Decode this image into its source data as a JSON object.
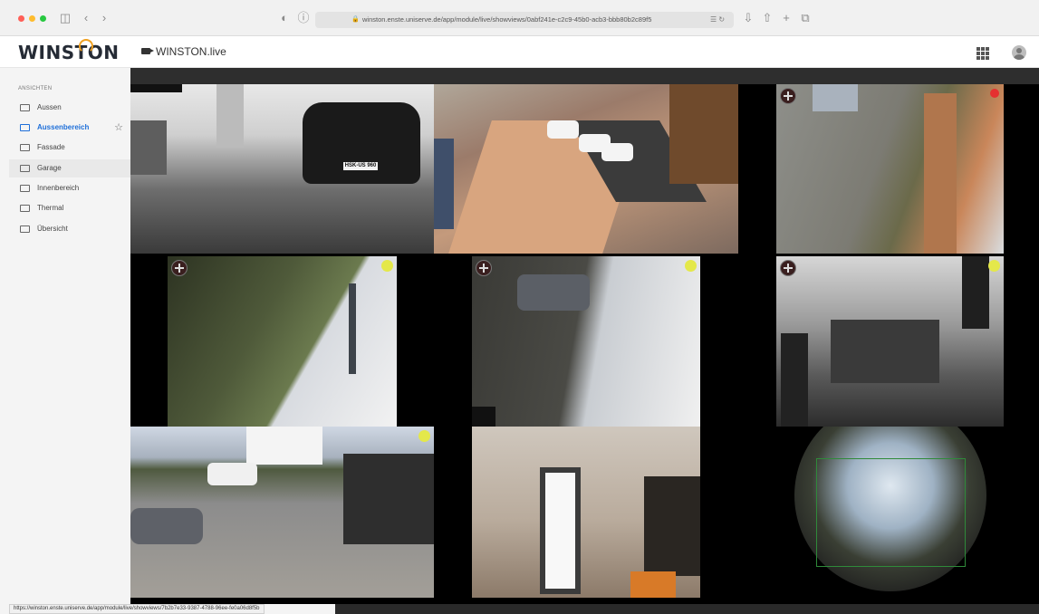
{
  "browser": {
    "url": "winston.enste.uniserve.de/app/module/live/showviews/0abf241e-c2c9-45b0-acb3-bbb80b2c89f5",
    "status_url": "https://winston.enste.uniserve.de/app/module/live/showviews/7b2b7e33-9387-4788-96ee-fe0a06d8f5b"
  },
  "header": {
    "logo": "WINSTON",
    "title": "WINSTON.live"
  },
  "sidebar": {
    "heading": "ANSICHTEN",
    "items": [
      {
        "label": "Aussen"
      },
      {
        "label": "Aussenbereich",
        "active": true
      },
      {
        "label": "Fassade"
      },
      {
        "label": "Garage"
      },
      {
        "label": "Innenbereich"
      },
      {
        "label": "Thermal"
      },
      {
        "label": "Übersicht"
      }
    ]
  },
  "cameras": {
    "plate_text": "HSK-US 960",
    "count": 9
  },
  "colors": {
    "accent": "#1e6fd9",
    "logo_ring": "#f0a020",
    "indicator": "#e4e84a"
  }
}
